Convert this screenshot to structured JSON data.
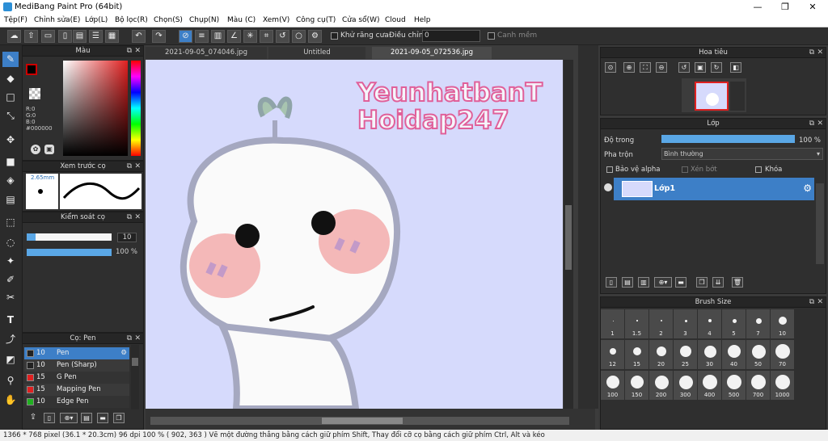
{
  "window": {
    "title": "MediBang Paint Pro (64bit)",
    "min": "—",
    "max": "❐",
    "close": "✕"
  },
  "menu": [
    "Tệp(F)",
    "Chỉnh sửa(E)",
    "Lớp(L)",
    "Bộ lọc(R)",
    "Chọn(S)",
    "Chụp(N)",
    "Màu (C)",
    "Xem(V)",
    "Công cụ(T)",
    "Cửa sổ(W)",
    "Cloud",
    "Help"
  ],
  "toolbar": {
    "antialias_label": "Khử răng cưa",
    "adjust_label": "Điều chỉnh",
    "adjust_value": "0",
    "snap_label": "Canh mềm"
  },
  "color_panel": {
    "title": "Màu",
    "r": "R:0",
    "g": "G:0",
    "b": "B:0",
    "hex": "#000000"
  },
  "brush_preview": {
    "title": "Xem trước cọ",
    "size": "2.65mm"
  },
  "brush_control": {
    "title": "Kiểm soát cọ",
    "size_value": "10",
    "opacity_value": "100 %",
    "size_fraction": 0.1,
    "opacity_fraction": 1.0
  },
  "brush_list": {
    "title": "Cọ: Pen",
    "items": [
      {
        "size": "10",
        "name": "Pen",
        "color": "#222222",
        "selected": true
      },
      {
        "size": "10",
        "name": "Pen (Sharp)",
        "color": "#222222",
        "selected": false
      },
      {
        "size": "15",
        "name": "G Pen",
        "color": "#e02020",
        "selected": false
      },
      {
        "size": "15",
        "name": "Mapping Pen",
        "color": "#e02020",
        "selected": false
      },
      {
        "size": "10",
        "name": "Edge Pen",
        "color": "#20b020",
        "selected": false
      }
    ]
  },
  "tabs": [
    "2021-09-05_074046.jpg",
    "Untitled",
    "2021-09-05_072536.jpg"
  ],
  "canvas": {
    "watermark_line1": "YeunhatbanT",
    "watermark_line2": "Hoidap247"
  },
  "navigator": {
    "title": "Hoa tiêu"
  },
  "layer_panel": {
    "title": "Lớp",
    "opacity_label": "Độ trong",
    "opacity_value": "100 %",
    "opacity_fraction": 1.0,
    "blend_label": "Pha trộn",
    "blend_value": "Bình thường",
    "protect_alpha": "Bảo vệ alpha",
    "clip": "Xén bớt",
    "lock": "Khóa",
    "layer_name": "Lớp1"
  },
  "brush_size": {
    "title": "Brush Size",
    "sizes": [
      "1",
      "1.5",
      "2",
      "3",
      "4",
      "5",
      "7",
      "10",
      "12",
      "15",
      "20",
      "25",
      "30",
      "40",
      "50",
      "70",
      "100",
      "150",
      "200",
      "300",
      "400",
      "500",
      "700",
      "1000"
    ]
  },
  "status": {
    "text": "1366 * 768 pixel   (36.1 * 20.3cm)   96 dpi   100 %   ( 902, 363 )   Vẽ một đường thẳng bằng cách giữ phím Shift, Thay đổi cỡ cọ bằng cách giữ phím Ctrl, Alt và kéo"
  },
  "colors": {
    "accent": "#3d7fc7",
    "canvas_bg": "#d6dafc",
    "watermark": "#e0609a"
  }
}
